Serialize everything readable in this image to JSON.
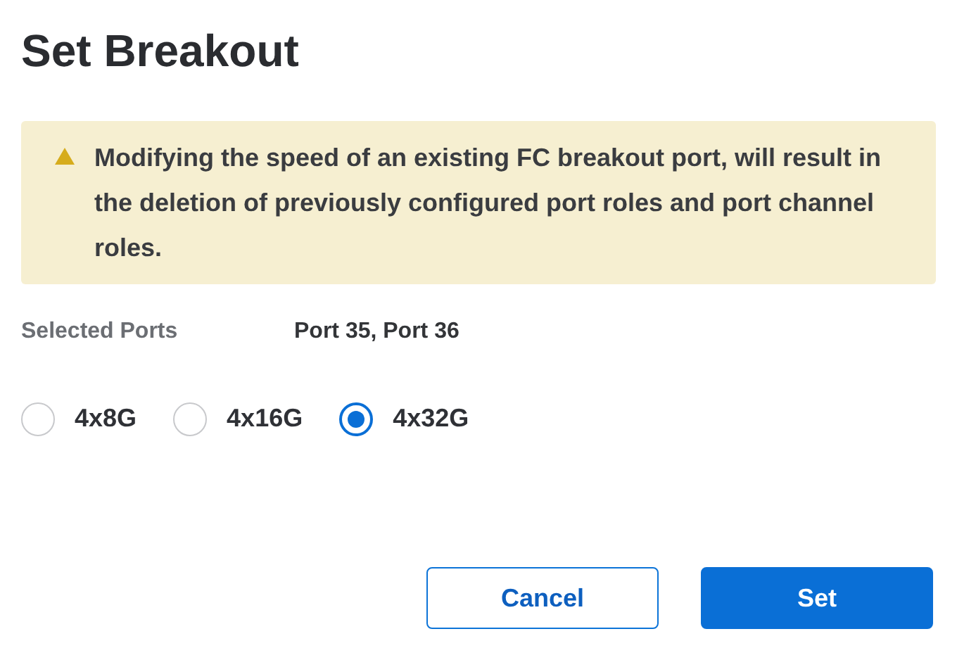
{
  "title": "Set Breakout",
  "warning": {
    "text": "Modifying the speed of an existing FC breakout port, will result in the deletion of previously configured port roles and port channel roles."
  },
  "selected_ports": {
    "label": "Selected Ports",
    "value": "Port 35, Port 36"
  },
  "speeds": [
    {
      "label": "4x8G",
      "selected": false
    },
    {
      "label": "4x16G",
      "selected": false
    },
    {
      "label": "4x32G",
      "selected": true
    }
  ],
  "buttons": [
    {
      "label": "Cancel",
      "kind": "secondary"
    },
    {
      "label": "Set",
      "kind": "primary"
    }
  ]
}
